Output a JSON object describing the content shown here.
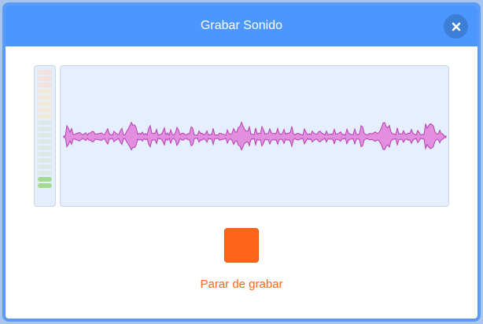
{
  "dialog": {
    "title": "Grabar Sonido",
    "close_icon": "close-icon",
    "stop_button_icon": "stop-square-icon",
    "stop_label": "Parar de grabar"
  },
  "level_meter": {
    "segments": 19,
    "active_segments": 2
  },
  "colors": {
    "header": "#4c97ff",
    "accent": "#ff6619",
    "waveform_fill": "#e38fe0",
    "waveform_stroke": "#b63fb3",
    "meter_active": "#a3dc91"
  }
}
